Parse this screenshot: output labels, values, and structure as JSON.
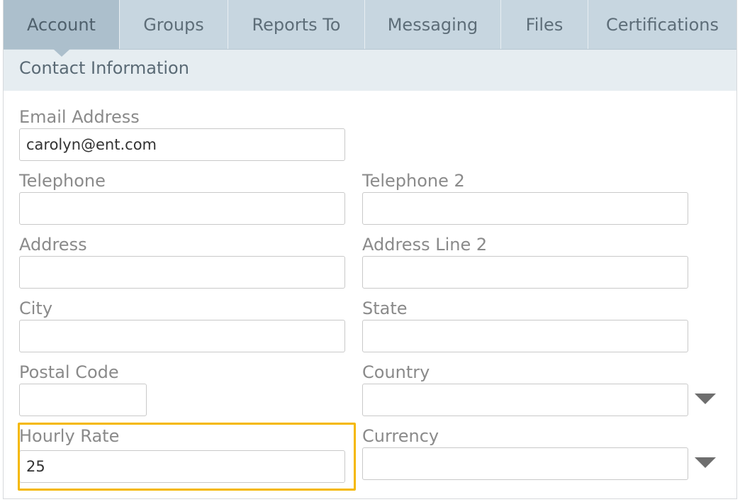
{
  "tabs": [
    {
      "label": "Account",
      "active": true
    },
    {
      "label": "Groups"
    },
    {
      "label": "Reports To"
    },
    {
      "label": "Messaging"
    },
    {
      "label": "Files"
    },
    {
      "label": "Certifications"
    }
  ],
  "section": {
    "title": "Contact Information"
  },
  "fields": {
    "email": {
      "label": "Email Address",
      "value": "carolyn@ent.com"
    },
    "telephone": {
      "label": "Telephone",
      "value": ""
    },
    "telephone2": {
      "label": "Telephone 2",
      "value": ""
    },
    "address": {
      "label": "Address",
      "value": ""
    },
    "address2": {
      "label": "Address Line 2",
      "value": ""
    },
    "city": {
      "label": "City",
      "value": ""
    },
    "state": {
      "label": "State",
      "value": ""
    },
    "postal_code": {
      "label": "Postal Code",
      "value": ""
    },
    "country": {
      "label": "Country",
      "value": ""
    },
    "hourly_rate": {
      "label": "Hourly Rate",
      "value": "25"
    },
    "currency": {
      "label": "Currency",
      "value": ""
    }
  },
  "colors": {
    "highlight": "#f5b800",
    "tab_bar": "#c7d6e0",
    "tab_active": "#acbfcc",
    "section_bar": "#e6edf1"
  }
}
